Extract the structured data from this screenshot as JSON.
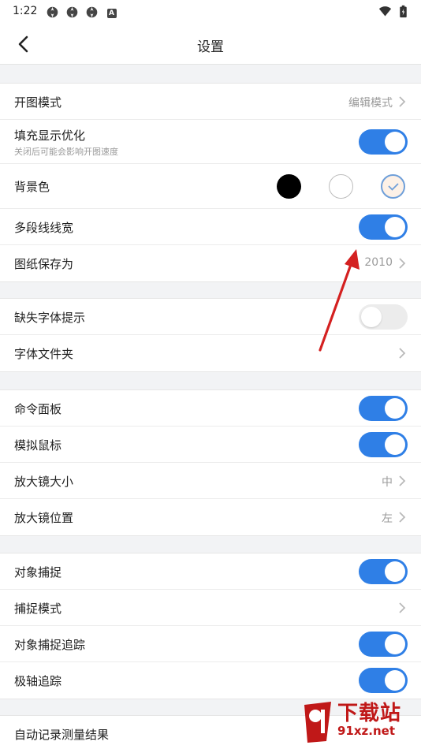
{
  "status": {
    "time": "1:22",
    "icons": [
      "aperture-icon",
      "aperture-icon",
      "aperture-icon",
      "a-box-icon"
    ],
    "a_letter": "A",
    "right_icons": [
      "wifi-icon",
      "battery-icon"
    ]
  },
  "appbar": {
    "title": "设置",
    "back_icon": "chevron-left-icon"
  },
  "group1": {
    "open_mode": {
      "label": "开图模式",
      "value": "编辑模式"
    },
    "fill_opt": {
      "label": "填充显示优化",
      "sub": "关闭后可能会影响开图速度",
      "on": true
    },
    "bg_color": {
      "label": "背景色",
      "options": [
        "#000000",
        "#ffffff",
        "#fdf1e7"
      ],
      "selected": 2
    },
    "polyline": {
      "label": "多段线线宽",
      "on": true
    },
    "save_as": {
      "label": "图纸保存为",
      "value": "2010"
    }
  },
  "group2": {
    "missing_font": {
      "label": "缺失字体提示",
      "on": false
    },
    "font_folder": {
      "label": "字体文件夹"
    }
  },
  "group3": {
    "cmd_panel": {
      "label": "命令面板",
      "on": true
    },
    "sim_mouse": {
      "label": "模拟鼠标",
      "on": true
    },
    "mag_size": {
      "label": "放大镜大小",
      "value": "中"
    },
    "mag_pos": {
      "label": "放大镜位置",
      "value": "左"
    }
  },
  "group4": {
    "snap": {
      "label": "对象捕捉",
      "on": true
    },
    "snap_mode": {
      "label": "捕捉模式"
    },
    "snap_track": {
      "label": "对象捕捉追踪",
      "on": true
    },
    "polar_track": {
      "label": "极轴追踪",
      "on": true
    }
  },
  "group5": {
    "auto_record": {
      "label": "自动记录测量结果"
    }
  },
  "colors": {
    "accent": "#2f7fe6",
    "toggle_off": "#ececec",
    "annotation_arrow": "#d42020",
    "watermark": "#c01818"
  },
  "watermark": {
    "text": "下载站",
    "url": "91xz.net"
  }
}
